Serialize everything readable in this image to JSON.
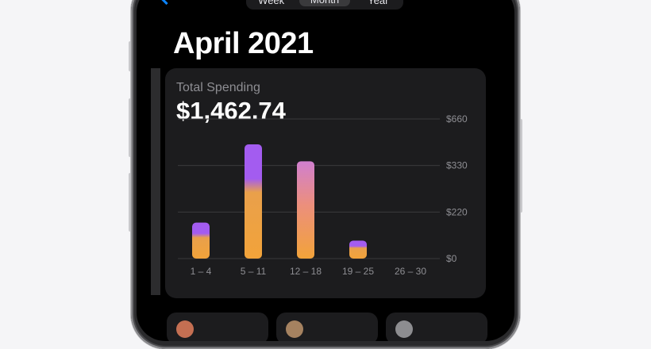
{
  "segmented": {
    "items": [
      {
        "label": "Week"
      },
      {
        "label": "Month"
      },
      {
        "label": "Year"
      }
    ],
    "selected": "Month"
  },
  "page": {
    "title": "April 2021"
  },
  "summary": {
    "label": "Total Spending",
    "total": "$1,462.74"
  },
  "colors": {
    "accent_purple": "#a35cf0",
    "accent_orange": "#f2a33a",
    "back_chevron": "#0a84ff"
  },
  "chart_data": {
    "type": "bar",
    "categories": [
      "1 – 4",
      "5 – 11",
      "12 – 18",
      "19 – 25",
      "26 – 30"
    ],
    "values": [
      170,
      540,
      460,
      85,
      0
    ],
    "y_ticks": [
      "$660",
      "$330",
      "$220",
      "$0"
    ],
    "ylim": [
      0,
      660
    ],
    "grid": true
  },
  "icons": [
    "chevron-left-icon"
  ]
}
